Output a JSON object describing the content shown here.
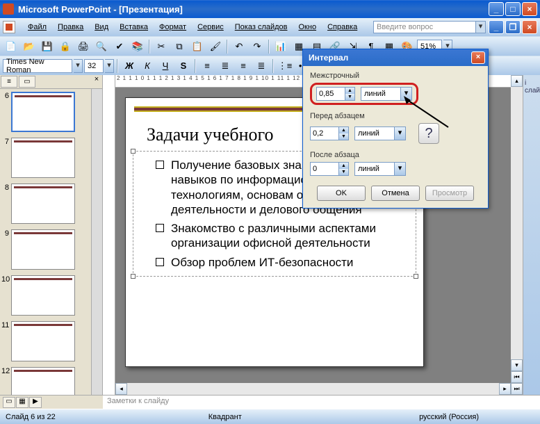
{
  "app": {
    "title": "Microsoft PowerPoint - [Презентация]"
  },
  "menu": {
    "items": [
      "Файл",
      "Правка",
      "Вид",
      "Вставка",
      "Формат",
      "Сервис",
      "Показ слайдов",
      "Окно",
      "Справка"
    ],
    "help_placeholder": "Введите вопрос"
  },
  "format_bar": {
    "font_name": "Times New Roman",
    "font_size": "32",
    "zoom": "51%",
    "task_pane_label": "і слайд"
  },
  "thumbs": {
    "numbers": [
      "6",
      "7",
      "8",
      "9",
      "10",
      "11",
      "12"
    ],
    "selected": 0
  },
  "ruler": "2 1 1 1 0 1 1 1 2 1 3 1 4 1 5 1 6 1 7 1 8 1 9 1 10 1 11 1 12",
  "slide": {
    "title": "Задачи учебного",
    "bullets": [
      "Получение базовых знаний, умений и навыков по информационным технологиям, основам офисной деятельности и делового общения",
      "Знакомство с различными аспектами организации офисной деятельности",
      "Обзор проблем ИТ-безопасности"
    ]
  },
  "notes": {
    "placeholder": "Заметки к слайду"
  },
  "status": {
    "slide": "Слайд 6 из 22",
    "layout": "Квадрант",
    "lang": "русский (Россия)"
  },
  "dialog": {
    "title": "Интервал",
    "line_spacing": {
      "label": "Межстрочный",
      "value": "0,85",
      "unit": "линий"
    },
    "before": {
      "label": "Перед абзацем",
      "value": "0,2",
      "unit": "линий"
    },
    "after": {
      "label": "После абзаца",
      "value": "0",
      "unit": "линий"
    },
    "ok": "OK",
    "cancel": "Отмена",
    "preview": "Просмотр",
    "help": "?"
  }
}
